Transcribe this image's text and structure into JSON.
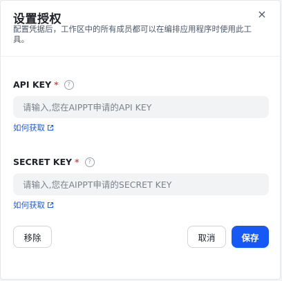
{
  "dialog": {
    "title": "设置授权",
    "close_symbol": "×",
    "description": "配置凭据后，工作区中的所有成员都可以在编排应用程序时使用此工具。"
  },
  "api_key": {
    "label": "API KEY",
    "required_mark": "*",
    "help_symbol": "?",
    "placeholder": "请输入,您在AIPPT申请的API KEY",
    "value": "",
    "link_text": "如何获取"
  },
  "secret_key": {
    "label": "SECRET KEY",
    "required_mark": "*",
    "help_symbol": "?",
    "placeholder": "请输入,您在AIPPT申请的SECRET KEY",
    "value": "",
    "link_text": "如何获取"
  },
  "footer": {
    "remove_label": "移除",
    "cancel_label": "取消",
    "save_label": "保存"
  },
  "icons": {
    "close": "close-icon",
    "help": "help-circle-icon",
    "external": "external-link-icon"
  },
  "colors": {
    "primary": "#1659f5",
    "link": "#1e5bdc",
    "required": "#e5484d",
    "input_bg": "#f2f3f5"
  }
}
